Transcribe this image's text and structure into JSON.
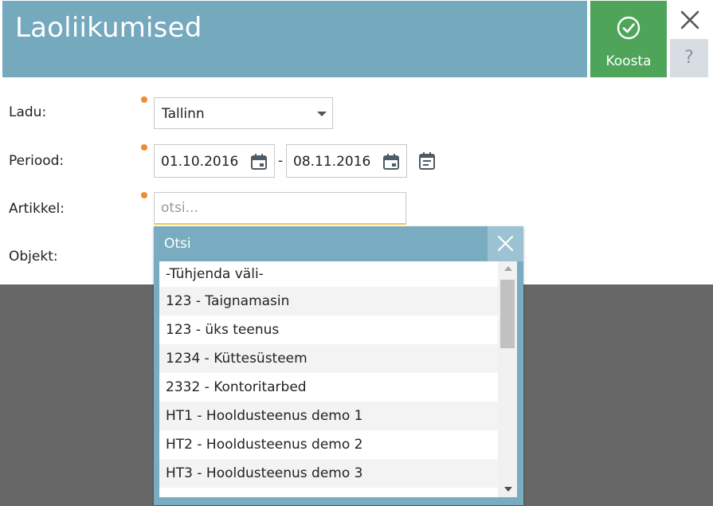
{
  "header": {
    "title": "Laoliikumised",
    "koosta_label": "Koosta",
    "help_label": "?"
  },
  "form": {
    "ladu": {
      "label": "Ladu:",
      "value": "Tallinn"
    },
    "periood": {
      "label": "Periood:",
      "from": "01.10.2016",
      "separator": "-",
      "to": "08.11.2016"
    },
    "artikkel": {
      "label": "Artikkel:",
      "placeholder": "otsi..."
    },
    "objekt": {
      "label": "Objekt:"
    }
  },
  "dropdown": {
    "title": "Otsi",
    "items": [
      "-Tühjenda väli-",
      "123 - Taignamasin",
      "123 - üks teenus",
      "1234 - Küttesüsteem",
      "2332 - Kontoritarbed",
      "HT1 - Hooldusteenus demo 1",
      "HT2 - Hooldusteenus demo 2",
      "HT3 - Hooldusteenus demo 3"
    ]
  },
  "colors": {
    "header_bg": "#74a9be",
    "koosta_bg": "#4ea55a",
    "required_dot": "#ef8b2c",
    "overlay": "#676767"
  },
  "icons": {
    "koosta": "check-circle-icon",
    "close": "close-icon",
    "date": "calendar-icon",
    "period": "calendar-list-icon"
  }
}
